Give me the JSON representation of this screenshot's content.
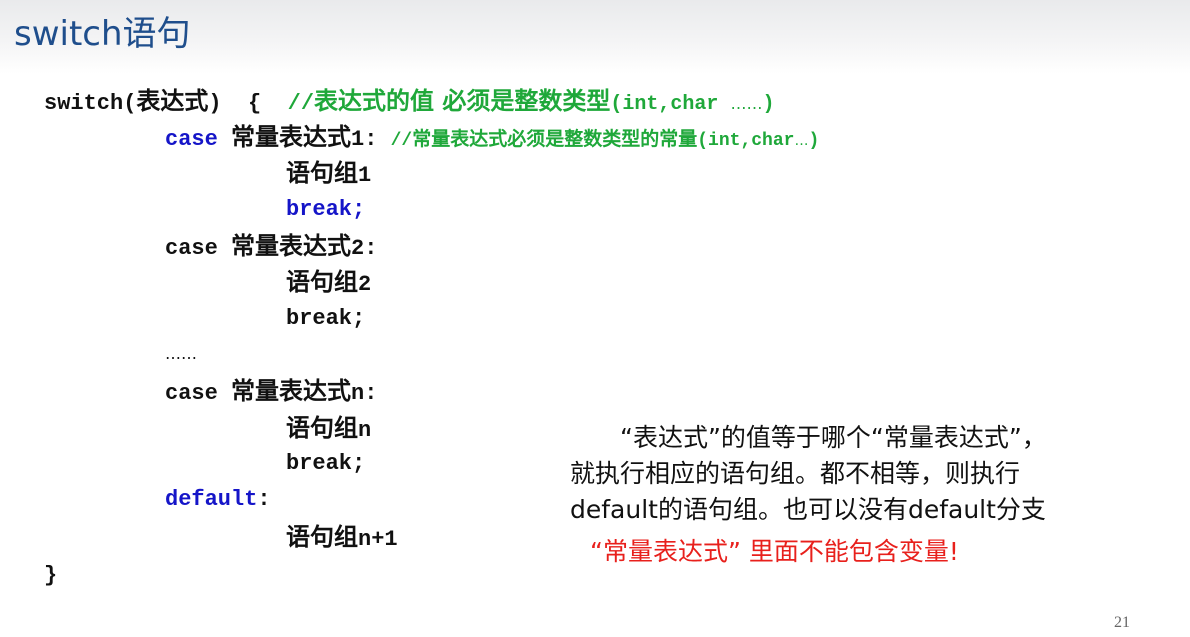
{
  "slide": {
    "title": "switch语句",
    "page_number": "21"
  },
  "code": {
    "switch_kw": "switch",
    "switch_open": "(",
    "switch_expr": "表达式",
    "switch_close": ")",
    "brace_open": "{",
    "comment1_slashes": "//",
    "comment1_cjk": "表达式的值  必须是整数类型",
    "comment1_tail_open": "(int,char ",
    "comment1_tail_dots": "……",
    "comment1_tail_close": ")",
    "case1_kw": "case",
    "case1_label": "常量表达式",
    "case1_num": "1:",
    "comment2_slashes": "//",
    "comment2_cjk": "常量表达式必须是整数类型的常量",
    "comment2_tail_open": "(int,char",
    "comment2_tail_dots": "…",
    "comment2_tail_close": ")",
    "group1_label": "语句组",
    "group1_num": "1",
    "break1": "break;",
    "case2_kw": "case",
    "case2_label": "常量表达式",
    "case2_num": "2:",
    "group2_label": "语句组",
    "group2_num": "2",
    "break2": "break;",
    "ellipsis": "……",
    "casen_kw": "case",
    "casen_label": "常量表达式",
    "casen_num": "n:",
    "groupn_label": "语句组",
    "groupn_num": "n",
    "breakn": "break;",
    "default_kw": "default",
    "default_colon": ":",
    "groupn1_label": "语句组",
    "groupn1_num": "n+1",
    "brace_close": "}"
  },
  "note": {
    "line1": "“表达式”的值等于哪个“常量表达式”，",
    "line2": "就执行相应的语句组。都不相等，则执行",
    "line3": "default的语句组。也可以没有default分支",
    "warning": "“常量表达式” 里面不能包含变量!"
  },
  "colors": {
    "title": "#1f4e8c",
    "keyword_blue": "#1515c8",
    "comment_green": "#1fa83a",
    "warning_red": "#e8201c"
  }
}
